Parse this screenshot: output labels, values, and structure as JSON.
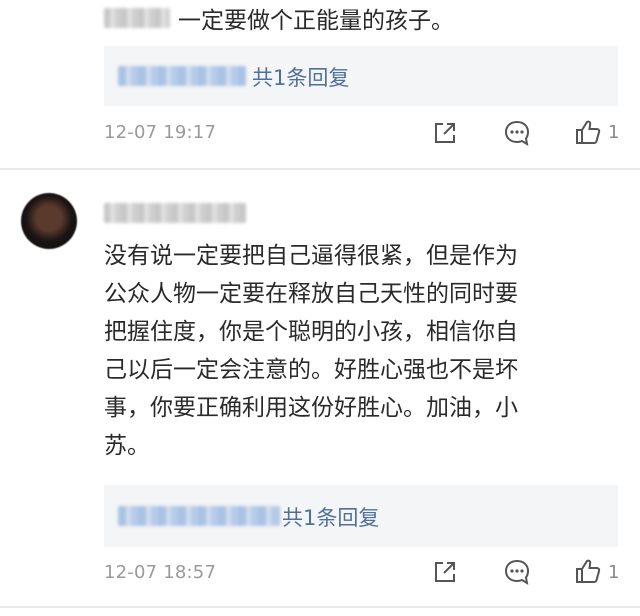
{
  "comments": [
    {
      "text_lines": [
        "一定要做个正能量的孩子。"
      ],
      "reply_label": "共1条回复",
      "time": "12-07 19:17",
      "like_count": "1"
    },
    {
      "text_lines": [
        "没有说一定要把自己逼得很紧，但是作为",
        "公众人物一定要在释放自己天性的同时要",
        "把握住度，你是个聪明的小孩，相信你自",
        "己以后一定会注意的。好胜心强也不是坏",
        "事，你要正确利用这份好胜心。加油，小",
        "苏。"
      ],
      "reply_label": "共1条回复",
      "time": "12-07 18:57",
      "like_count": "1"
    }
  ],
  "icons": {
    "share": "share-icon",
    "comment": "comment-icon",
    "like": "thumbs-up-icon"
  },
  "colors": {
    "reply_link": "#50709c",
    "meta_text": "#9a9a9a",
    "reply_bg": "#f4f5f7"
  }
}
